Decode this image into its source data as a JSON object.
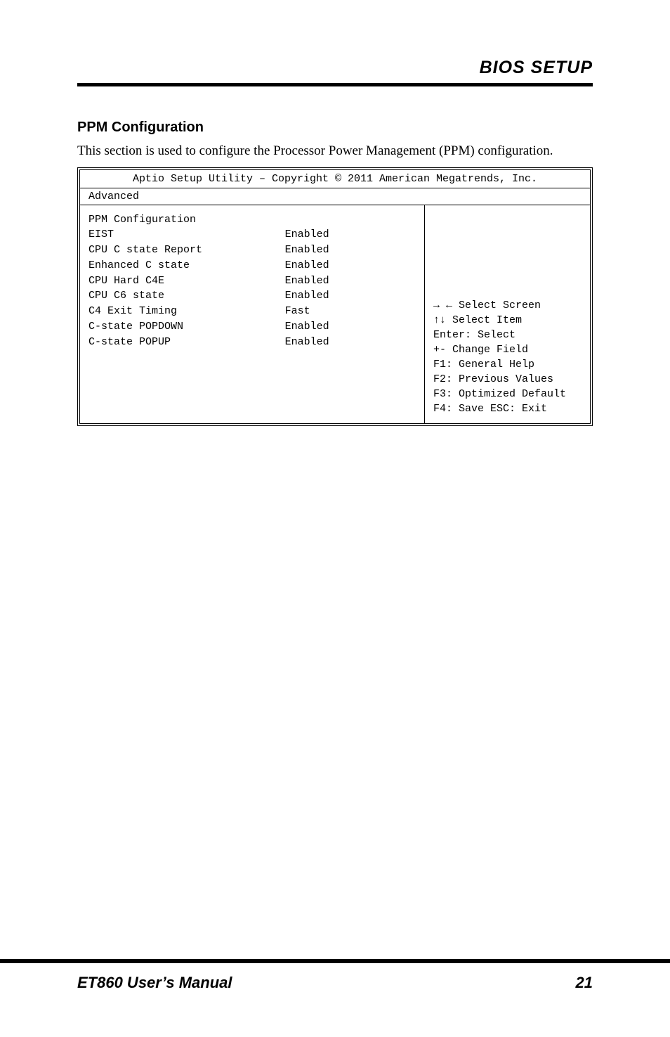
{
  "header": {
    "title": "BIOS SETUP"
  },
  "section": {
    "heading": "PPM Configuration",
    "intro": "This section is used to configure the Processor Power Management (PPM) configuration.",
    "table_caption": "Aptio Setup Utility – Copyright © 2011 American Megatrends, Inc.",
    "tab_label": "Advanced"
  },
  "settings": [
    {
      "label": "PPM Configuration",
      "value": ""
    },
    {
      "label": "",
      "value": ""
    },
    {
      "label": "EIST",
      "value": "Enabled"
    },
    {
      "label": "CPU C state Report",
      "value": "Enabled"
    },
    {
      "label": "Enhanced C state",
      "value": "Enabled"
    },
    {
      "label": "CPU Hard C4E",
      "value": "Enabled"
    },
    {
      "label": "CPU C6 state",
      "value": "Enabled"
    },
    {
      "label": "C4 Exit Timing",
      "value": "Fast"
    },
    {
      "label": "C-state POPDOWN",
      "value": "Enabled"
    },
    {
      "label": "C-state POPUP",
      "value": "Enabled"
    }
  ],
  "help": {
    "line1": "→ ← Select Screen",
    "line2": "↑↓  Select Item",
    "line3": "Enter: Select",
    "line4": "+-   Change Field",
    "line5": "F1:  General Help",
    "line6": "F2:  Previous Values",
    "line7": "F3: Optimized Default",
    "line8": "F4: Save  ESC: Exit"
  },
  "footer": {
    "left": "ET860 User’s Manual",
    "right": "21"
  }
}
